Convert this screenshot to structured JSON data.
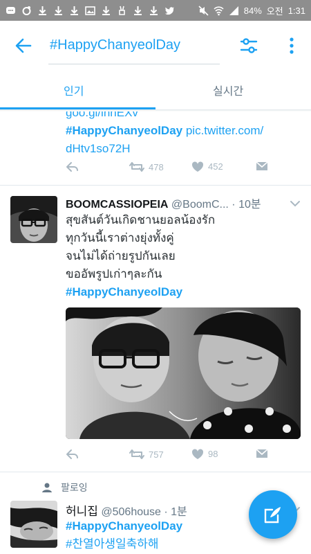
{
  "status_bar": {
    "battery": "84%",
    "period": "오전",
    "clock": "1:31"
  },
  "search": {
    "query": "#HappyChanyeolDay"
  },
  "tabs": {
    "popular": "인기",
    "live": "실시간"
  },
  "tweets": [
    {
      "partial_line_1": "goo.gl/lnhEXv",
      "hashtag": "#HappyChanyeolDay",
      "link_a": " pic.twitter.com/",
      "link_b": "dHtv1so72H",
      "retweets": "478",
      "likes": "452"
    },
    {
      "name": "BOOMCASSIOPEIA",
      "handle": "@BoomC...",
      "separator": " · ",
      "time": "10분",
      "lines": [
        "สุขสันต์วันเกิดชานยอลน้องรัก",
        "ทุกวันนี้เราต่างยุ่งทั้งคู่",
        "จนไม่ได้ถ่ายรูปกันเลย",
        "ขออัพรูปเก่าๆละกัน"
      ],
      "hashtag": "#HappyChanyeolDay",
      "retweets": "757",
      "likes": "98"
    },
    {
      "context": "팔로잉",
      "name": "허니집",
      "handle": "@506house",
      "separator": " · ",
      "time": "1분",
      "hashtag_1": "#HappyChanyeolDay",
      "hashtag_2": "#찬열아생일축하해"
    }
  ],
  "colors": {
    "accent": "#1da1f2",
    "action_gray": "#aab8c2",
    "status_bar": "#8e8e8e"
  },
  "icons": {
    "back": "arrow-left-icon",
    "filter": "sliders-icon",
    "more": "more-vertical-icon",
    "reply": "reply-icon",
    "retweet": "retweet-icon",
    "like": "heart-icon",
    "dm": "envelope-icon",
    "compose": "compose-tweet-icon",
    "follow": "person-icon",
    "caret": "chevron-down-icon"
  }
}
